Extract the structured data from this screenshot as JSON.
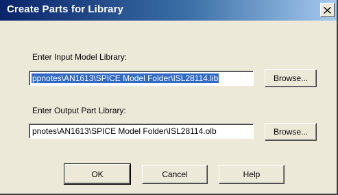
{
  "window": {
    "title": "Create Parts for Library",
    "close_icon": "close-icon"
  },
  "input_library": {
    "label": "Enter Input Model Library:",
    "value": "ppnotes\\AN1613\\SPICE Model Folder\\ISL28114.lib",
    "browse_label": "Browse..."
  },
  "output_library": {
    "label": "Enter Output Part Library:",
    "value": "pnotes\\AN1613\\SPICE Model Folder\\ISL28114.olb",
    "browse_label": "Browse..."
  },
  "buttons": {
    "ok_label": "OK",
    "cancel_label": "Cancel",
    "help_label": "Help"
  },
  "colors": {
    "title_bar_start": "#0a246a",
    "title_bar_end": "#a6caf0",
    "dialog_bg": "#ece9d8",
    "selection": "#316ac5"
  }
}
